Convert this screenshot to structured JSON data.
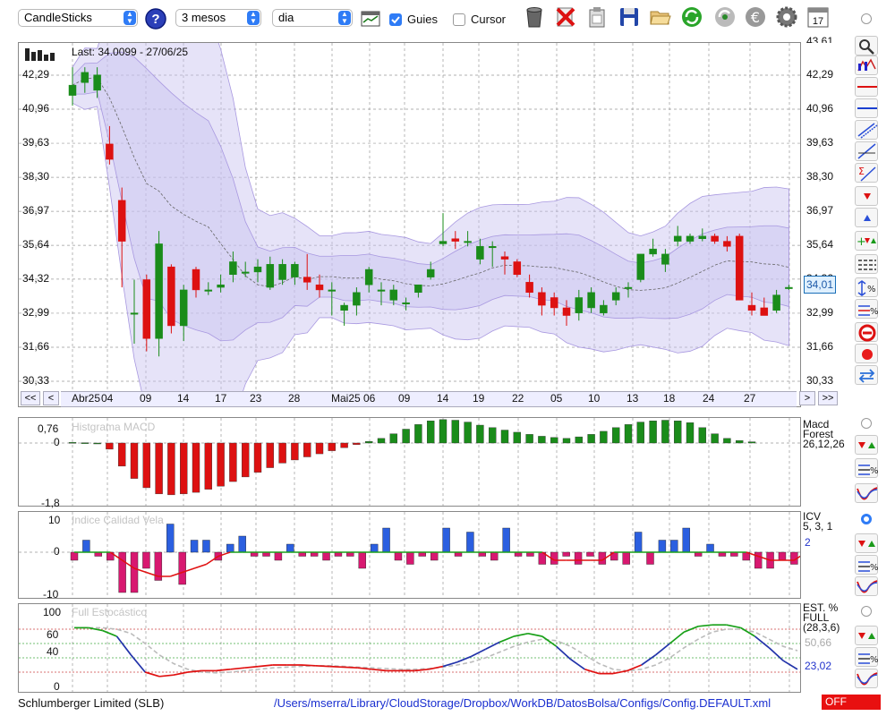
{
  "toolbar": {
    "symbol_select": "CandleSticks",
    "period_select": "3 mesos",
    "interval_select": "dia",
    "guies_label": "Guies",
    "guies_checked": true,
    "cursor_label": "Cursor",
    "cursor_checked": false,
    "icons": [
      "help-icon",
      "calendar-grid-icon",
      "trash-icon",
      "delete-icon",
      "clipboard-icon",
      "save-icon",
      "open-folder-icon",
      "refresh-icon",
      "reload-icon",
      "euro-icon",
      "gear-icon",
      "calendar-icon"
    ],
    "calendar_day": "17"
  },
  "main_chart": {
    "last_label": "Last: 34.0099 - 27/06/25",
    "y_ticks": [
      "42,29",
      "40,96",
      "39,63",
      "38,30",
      "36,97",
      "35,64",
      "34,32",
      "32,99",
      "31,66",
      "30,33"
    ],
    "y_top_partial": "43,61",
    "current_value": "34,01",
    "x_ticks": [
      "Abr25",
      "04",
      "09",
      "14",
      "17",
      "23",
      "28",
      "Mai25",
      "06",
      "09",
      "14",
      "19",
      "22",
      "05",
      "10",
      "13",
      "18",
      "24",
      "27"
    ],
    "nav": {
      "first": "<<",
      "prev": "<",
      "next": ">",
      "last": ">>"
    }
  },
  "macd_panel": {
    "title": "Histgrama MACD",
    "y_ticks": [
      "0,76",
      "0",
      "-1,8"
    ],
    "right_label": [
      "Macd",
      "Forest",
      "26,12,26"
    ]
  },
  "icv_panel": {
    "title": "Indice Calidad Vela",
    "y_ticks": [
      "10",
      "0",
      "-10"
    ],
    "right_label": [
      "ICV",
      "5, 3, 1"
    ],
    "right_value": "2"
  },
  "stoch_panel": {
    "title": "Full Estocástico",
    "y_ticks": [
      "100",
      "60",
      "40",
      "0"
    ],
    "right_label": [
      "EST. %",
      "FULL",
      "(28,3,6)"
    ],
    "value_gray": "50,66",
    "value_blue": "23,02"
  },
  "status": {
    "company": "Schlumberger Limited (SLB)",
    "path": "/Users/mserra/Library/CloudStorage/Dropbox/WorkDB/DatosBolsa/Configs/Config.DEFAULT.xml",
    "state": "OFF"
  },
  "colors": {
    "up": "#1a8c1a",
    "down": "#dd1111",
    "band": "#c8c0f0",
    "accent": "#2f7cf6",
    "off": "#e81010"
  },
  "chart_data": {
    "type": "candlestick",
    "candles": [
      {
        "o": 41.5,
        "h": 42.6,
        "l": 41.1,
        "c": 41.9
      },
      {
        "o": 42.0,
        "h": 42.6,
        "l": 41.6,
        "c": 42.4
      },
      {
        "o": 41.7,
        "h": 42.6,
        "l": 41.4,
        "c": 42.3
      },
      {
        "o": 39.6,
        "h": 40.3,
        "l": 38.8,
        "c": 39.0
      },
      {
        "o": 37.4,
        "h": 37.9,
        "l": 34.0,
        "c": 35.8
      },
      {
        "o": 33.0,
        "h": 34.3,
        "l": 31.8,
        "c": 33.0
      },
      {
        "o": 34.3,
        "h": 34.5,
        "l": 31.5,
        "c": 32.0
      },
      {
        "o": 32.0,
        "h": 36.2,
        "l": 31.3,
        "c": 35.7
      },
      {
        "o": 34.8,
        "h": 34.9,
        "l": 32.2,
        "c": 32.5
      },
      {
        "o": 32.5,
        "h": 34.1,
        "l": 31.9,
        "c": 33.9
      },
      {
        "o": 34.7,
        "h": 34.8,
        "l": 33.6,
        "c": 33.9
      },
      {
        "o": 33.9,
        "h": 34.2,
        "l": 33.7,
        "c": 33.9
      },
      {
        "o": 34.0,
        "h": 34.5,
        "l": 33.8,
        "c": 34.1
      },
      {
        "o": 34.5,
        "h": 35.4,
        "l": 34.2,
        "c": 35.0
      },
      {
        "o": 34.6,
        "h": 35.0,
        "l": 34.4,
        "c": 34.6
      },
      {
        "o": 34.6,
        "h": 35.1,
        "l": 34.2,
        "c": 34.8
      },
      {
        "o": 34.0,
        "h": 35.2,
        "l": 33.9,
        "c": 34.9
      },
      {
        "o": 34.3,
        "h": 35.1,
        "l": 34.1,
        "c": 34.9
      },
      {
        "o": 34.4,
        "h": 35.0,
        "l": 34.1,
        "c": 34.9
      },
      {
        "o": 34.4,
        "h": 35.3,
        "l": 33.9,
        "c": 34.2
      },
      {
        "o": 34.1,
        "h": 34.5,
        "l": 33.6,
        "c": 33.9
      },
      {
        "o": 33.9,
        "h": 34.2,
        "l": 32.9,
        "c": 33.9
      },
      {
        "o": 33.1,
        "h": 33.4,
        "l": 32.5,
        "c": 33.3
      },
      {
        "o": 33.3,
        "h": 34.0,
        "l": 32.9,
        "c": 33.8
      },
      {
        "o": 34.1,
        "h": 34.8,
        "l": 33.8,
        "c": 34.7
      },
      {
        "o": 33.9,
        "h": 34.2,
        "l": 33.3,
        "c": 33.9
      },
      {
        "o": 33.5,
        "h": 34.1,
        "l": 33.3,
        "c": 33.9
      },
      {
        "o": 33.4,
        "h": 33.6,
        "l": 33.1,
        "c": 33.4
      },
      {
        "o": 33.8,
        "h": 34.1,
        "l": 33.6,
        "c": 34.1
      },
      {
        "o": 34.4,
        "h": 35.0,
        "l": 34.3,
        "c": 34.7
      },
      {
        "o": 35.7,
        "h": 36.9,
        "l": 35.6,
        "c": 35.8
      },
      {
        "o": 35.9,
        "h": 36.2,
        "l": 35.5,
        "c": 35.8
      },
      {
        "o": 35.8,
        "h": 36.2,
        "l": 35.6,
        "c": 35.8
      },
      {
        "o": 35.1,
        "h": 35.9,
        "l": 34.9,
        "c": 35.6
      },
      {
        "o": 35.6,
        "h": 35.8,
        "l": 34.8,
        "c": 35.6
      },
      {
        "o": 35.2,
        "h": 35.4,
        "l": 34.5,
        "c": 35.1
      },
      {
        "o": 35.0,
        "h": 35.1,
        "l": 34.4,
        "c": 34.5
      },
      {
        "o": 34.2,
        "h": 34.5,
        "l": 33.6,
        "c": 33.8
      },
      {
        "o": 33.8,
        "h": 34.0,
        "l": 32.9,
        "c": 33.3
      },
      {
        "o": 33.6,
        "h": 33.8,
        "l": 32.9,
        "c": 33.2
      },
      {
        "o": 33.2,
        "h": 33.5,
        "l": 32.5,
        "c": 32.9
      },
      {
        "o": 33.0,
        "h": 33.9,
        "l": 32.7,
        "c": 33.6
      },
      {
        "o": 33.2,
        "h": 34.0,
        "l": 33.0,
        "c": 33.8
      },
      {
        "o": 33.0,
        "h": 33.5,
        "l": 32.9,
        "c": 33.3
      },
      {
        "o": 33.5,
        "h": 34.0,
        "l": 33.3,
        "c": 33.8
      },
      {
        "o": 34.0,
        "h": 34.2,
        "l": 33.6,
        "c": 34.0
      },
      {
        "o": 34.3,
        "h": 35.3,
        "l": 34.2,
        "c": 35.3
      },
      {
        "o": 35.3,
        "h": 35.9,
        "l": 35.2,
        "c": 35.5
      },
      {
        "o": 34.9,
        "h": 35.5,
        "l": 34.6,
        "c": 35.3
      },
      {
        "o": 35.8,
        "h": 36.4,
        "l": 35.6,
        "c": 36.0
      },
      {
        "o": 35.8,
        "h": 36.1,
        "l": 35.7,
        "c": 36.0
      },
      {
        "o": 35.9,
        "h": 36.3,
        "l": 35.8,
        "c": 36.0
      },
      {
        "o": 36.0,
        "h": 36.1,
        "l": 35.7,
        "c": 35.8
      },
      {
        "o": 35.8,
        "h": 36.0,
        "l": 35.4,
        "c": 35.6
      },
      {
        "o": 36.0,
        "h": 36.1,
        "l": 33.8,
        "c": 33.5
      },
      {
        "o": 33.3,
        "h": 33.8,
        "l": 32.9,
        "c": 33.1
      },
      {
        "o": 33.2,
        "h": 33.6,
        "l": 32.9,
        "c": 32.9
      },
      {
        "o": 33.1,
        "h": 33.9,
        "l": 33.0,
        "c": 33.7
      },
      {
        "o": 34.0,
        "h": 34.1,
        "l": 33.9,
        "c": 34.0
      }
    ],
    "macd_hist": [
      0.02,
      0.01,
      0.0,
      -0.2,
      -0.75,
      -1.15,
      -1.45,
      -1.65,
      -1.68,
      -1.65,
      -1.6,
      -1.5,
      -1.4,
      -1.25,
      -1.1,
      -0.95,
      -0.8,
      -0.65,
      -0.55,
      -0.45,
      -0.35,
      -0.25,
      -0.15,
      -0.05,
      0.05,
      0.15,
      0.3,
      0.45,
      0.6,
      0.72,
      0.76,
      0.74,
      0.68,
      0.58,
      0.5,
      0.42,
      0.35,
      0.28,
      0.22,
      0.18,
      0.15,
      0.2,
      0.28,
      0.38,
      0.5,
      0.6,
      0.68,
      0.72,
      0.74,
      0.72,
      0.66,
      0.5,
      0.3,
      0.15,
      0.08,
      0.04
    ],
    "icv": [
      -2,
      3,
      -1,
      -2,
      -10,
      -10,
      -4,
      -7,
      7,
      -8,
      3,
      3,
      -2,
      2,
      4,
      -1,
      -1,
      -2,
      2,
      -1,
      -1,
      -2,
      -1,
      -1,
      -4,
      2,
      6,
      -2,
      -3,
      -1,
      -2,
      6,
      -1,
      5,
      -1,
      -2,
      6,
      -1,
      -1,
      -3,
      -3,
      -1,
      -3,
      -1,
      -3,
      -2,
      -3,
      5,
      -3,
      3,
      3,
      6,
      -1,
      2,
      -1,
      -1,
      -2,
      -4,
      -4,
      -2,
      -3,
      4,
      -4,
      3
    ],
    "icv_signal": [
      0,
      0,
      0,
      0,
      -2,
      -4,
      -5,
      -6,
      -6,
      -5,
      -4,
      -3,
      -1,
      0,
      0,
      0,
      0,
      0,
      0,
      0,
      0,
      0,
      0,
      0,
      0,
      0,
      0,
      0,
      0,
      0,
      0,
      0,
      0,
      0,
      0,
      0,
      0,
      0,
      0,
      0,
      -2,
      -2,
      -2,
      -2,
      -2,
      0,
      0,
      0,
      0,
      0,
      0,
      0,
      0,
      0,
      0,
      0,
      0,
      -1,
      -2,
      -2,
      -2,
      0,
      0,
      0
    ],
    "stoch_k": [
      82,
      82,
      78,
      70,
      44,
      20,
      14,
      16,
      20,
      22,
      22,
      24,
      26,
      28,
      30,
      30,
      30,
      29,
      28,
      27,
      26,
      24,
      22,
      22,
      22,
      24,
      28,
      34,
      42,
      52,
      62,
      70,
      74,
      70,
      56,
      38,
      24,
      18,
      18,
      22,
      30,
      44,
      60,
      76,
      84,
      86,
      86,
      82,
      70,
      54,
      36,
      24
    ],
    "stoch_d": [
      82,
      82,
      82,
      80,
      74,
      60,
      44,
      32,
      24,
      20,
      19,
      20,
      22,
      24,
      26,
      27,
      28,
      29,
      29,
      28,
      27,
      26,
      25,
      24,
      24,
      25,
      27,
      30,
      34,
      40,
      48,
      56,
      62,
      66,
      64,
      56,
      44,
      32,
      24,
      22,
      24,
      30,
      40,
      54,
      66,
      76,
      80,
      80,
      76,
      66,
      56,
      50
    ],
    "stoch_levels": [
      80,
      60,
      40,
      20
    ]
  }
}
